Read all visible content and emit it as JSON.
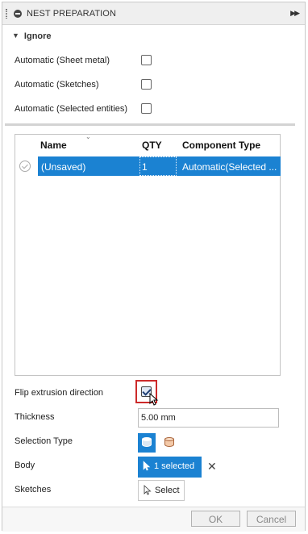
{
  "panel": {
    "title": "NEST PREPARATION",
    "expand_icon": "double-chevron-right-icon"
  },
  "ignore_group": {
    "title": "Ignore",
    "options": [
      {
        "label": "Automatic (Sheet metal)",
        "checked": false
      },
      {
        "label": "Automatic (Sketches)",
        "checked": false
      },
      {
        "label": "Automatic (Selected entities)",
        "checked": false
      }
    ]
  },
  "table": {
    "columns": [
      "Name",
      "QTY",
      "Component Type"
    ],
    "rows": [
      {
        "name": "(Unsaved)",
        "qty": "1",
        "component_type": "Automatic(Selected ...",
        "selected": true
      }
    ]
  },
  "form": {
    "flip_label": "Flip extrusion direction",
    "flip_checked": true,
    "thickness_label": "Thickness",
    "thickness_value": "5.00 mm",
    "selection_type_label": "Selection Type",
    "body_label": "Body",
    "body_button": "1 selected",
    "sketches_label": "Sketches",
    "sketches_button": "Select"
  },
  "footer": {
    "ok_label": "OK",
    "cancel_label": "Cancel"
  },
  "colors": {
    "accent": "#1b82d2",
    "highlight": "#cc2a2a"
  }
}
